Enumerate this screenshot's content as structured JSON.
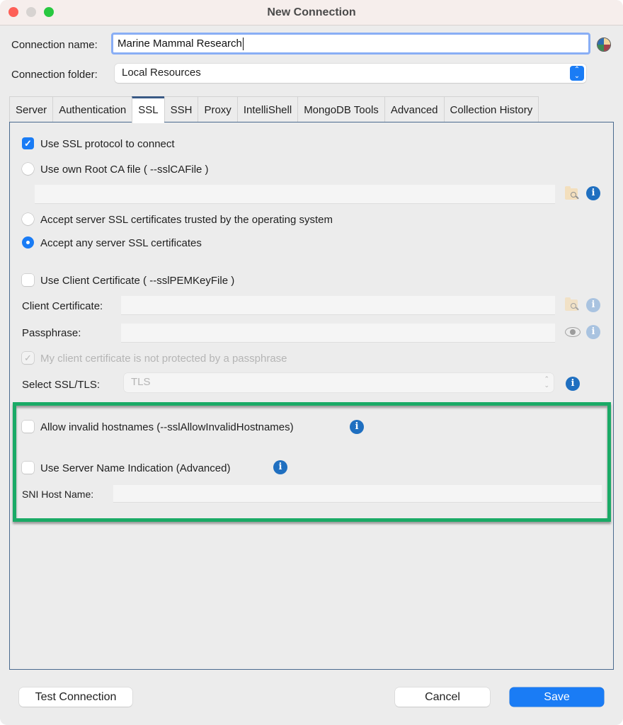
{
  "window": {
    "title": "New Connection"
  },
  "form": {
    "connection_name_label": "Connection name:",
    "connection_name_value": "Marine Mammal Research",
    "connection_folder_label": "Connection folder:",
    "connection_folder_value": "Local Resources"
  },
  "tabs": [
    {
      "label": "Server",
      "active": false
    },
    {
      "label": "Authentication",
      "active": false
    },
    {
      "label": "SSL",
      "active": true
    },
    {
      "label": "SSH",
      "active": false
    },
    {
      "label": "Proxy",
      "active": false
    },
    {
      "label": "IntelliShell",
      "active": false
    },
    {
      "label": "MongoDB Tools",
      "active": false
    },
    {
      "label": "Advanced",
      "active": false
    },
    {
      "label": "Collection History",
      "active": false
    }
  ],
  "ssl": {
    "use_ssl": {
      "label": "Use SSL protocol to connect",
      "checked": true
    },
    "root_ca": {
      "label": "Use own Root CA file ( --sslCAFile )",
      "selected": false,
      "value": ""
    },
    "trusted_os": {
      "label": "Accept server SSL certificates trusted by the operating system",
      "selected": false
    },
    "accept_any": {
      "label": "Accept any server SSL certificates",
      "selected": true
    },
    "client_cert": {
      "label": "Use Client Certificate ( --sslPEMKeyFile )",
      "checked": false
    },
    "client_certificate_label": "Client Certificate:",
    "client_certificate_value": "",
    "passphrase_label": "Passphrase:",
    "passphrase_value": "",
    "no_passphrase": {
      "label": "My client certificate is not protected by a passphrase",
      "checked": true,
      "disabled": true
    },
    "select_tls_label": "Select SSL/TLS:",
    "select_tls_value": "TLS",
    "allow_invalid_hostnames": {
      "label": "Allow invalid hostnames (--sslAllowInvalidHostnames)",
      "checked": false
    },
    "use_sni": {
      "label": "Use Server Name Indication (Advanced)",
      "checked": false
    },
    "sni_host_label": "SNI Host Name:",
    "sni_host_value": ""
  },
  "icons": {
    "info": "i",
    "check": "✓",
    "stepper_up": "⌃",
    "stepper_down": "⌄"
  },
  "buttons": {
    "test_connection": "Test Connection",
    "cancel": "Cancel",
    "save": "Save"
  },
  "colors": {
    "accent": "#1a7cf5",
    "highlight_border": "#1aaa66",
    "info_icon": "#1f6fc0",
    "active_tab_border": "#3a5a85"
  }
}
